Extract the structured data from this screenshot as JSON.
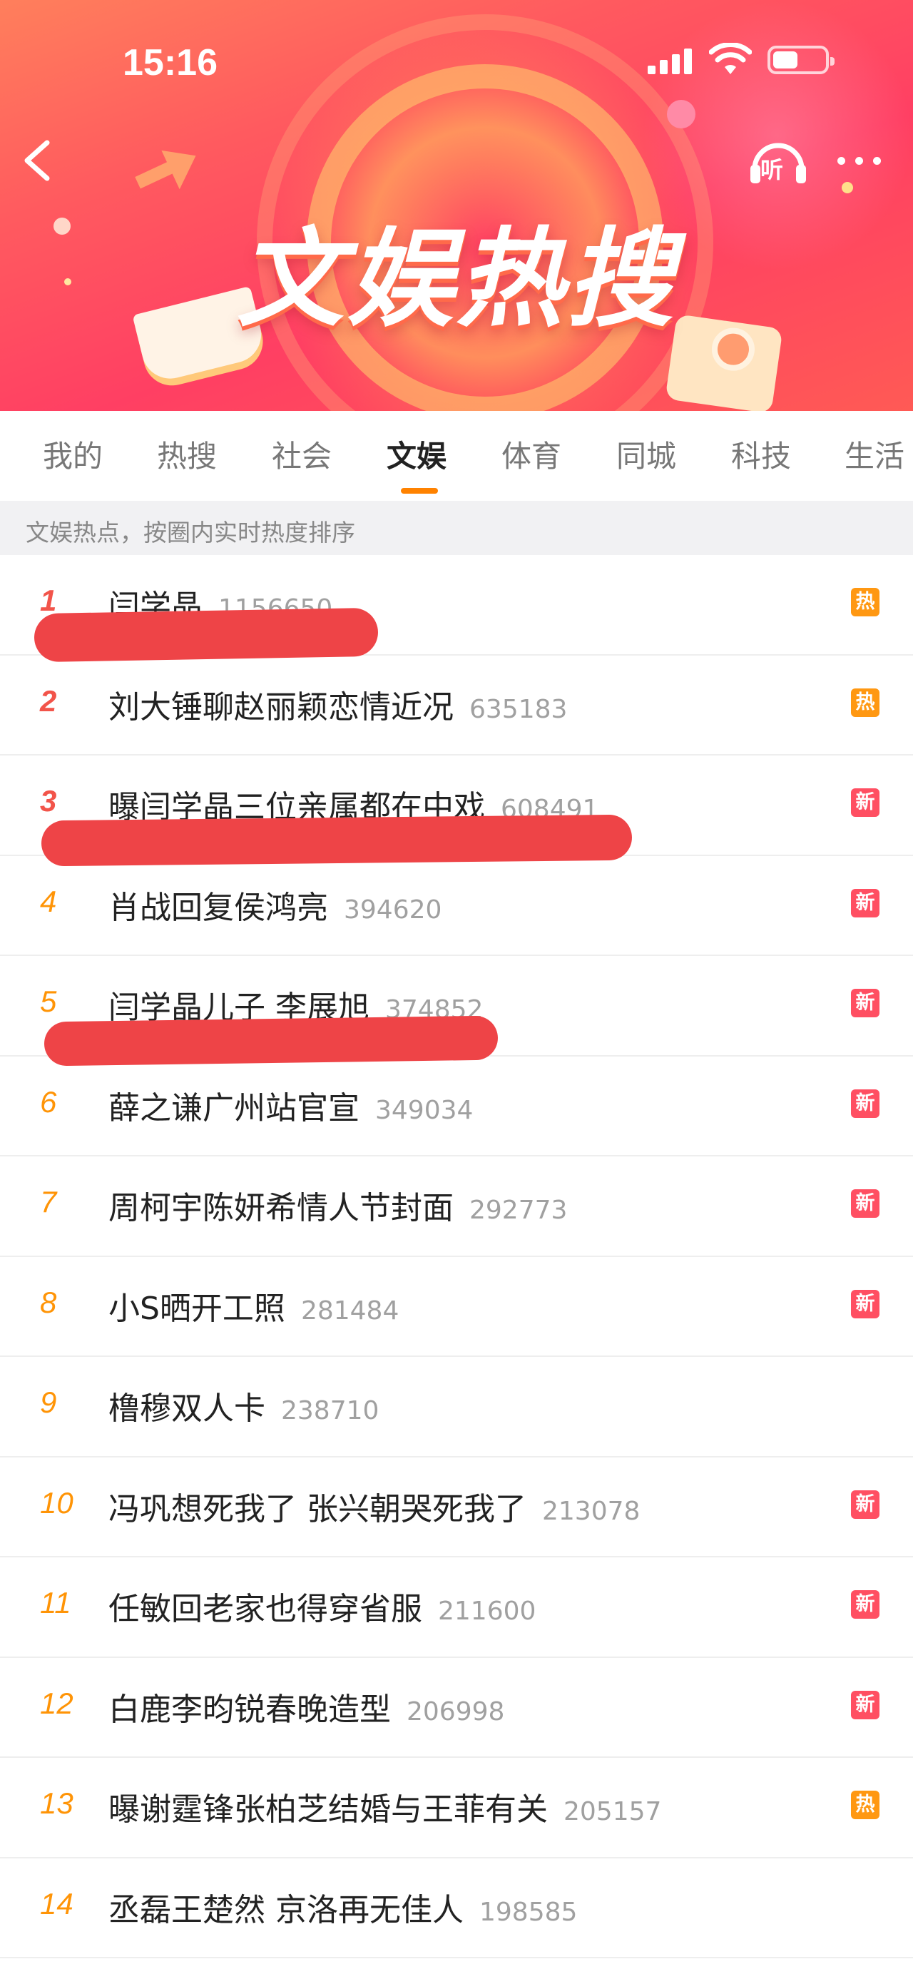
{
  "status_bar": {
    "time": "15:16"
  },
  "banner": {
    "title": "文娱热搜"
  },
  "header": {
    "listen_label": "听"
  },
  "tabs": [
    {
      "label": "我的"
    },
    {
      "label": "热搜"
    },
    {
      "label": "社会"
    },
    {
      "label": "文娱",
      "active": true
    },
    {
      "label": "体育"
    },
    {
      "label": "同城"
    },
    {
      "label": "科技"
    },
    {
      "label": "生活"
    }
  ],
  "subheader": "文娱热点，按圈内实时热度排序",
  "colors": {
    "accent": "#ff8200",
    "hot_badge": "#ff9812",
    "new_badge": "#ff4f62",
    "rank_top": "#f2544a",
    "rank": "#ff9406"
  },
  "list": [
    {
      "rank": "1",
      "topic": "闫学晶",
      "count": "1156650",
      "badge": "热",
      "badge_type": "hot"
    },
    {
      "rank": "2",
      "topic": "刘大锤聊赵丽颖恋情近况",
      "count": "635183",
      "badge": "热",
      "badge_type": "hot"
    },
    {
      "rank": "3",
      "topic": "曝闫学晶三位亲属都在中戏",
      "count": "608491",
      "badge": "新",
      "badge_type": "new"
    },
    {
      "rank": "4",
      "topic": "肖战回复侯鸿亮",
      "count": "394620",
      "badge": "新",
      "badge_type": "new"
    },
    {
      "rank": "5",
      "topic": "闫学晶儿子 李展旭",
      "count": "374852",
      "badge": "新",
      "badge_type": "new"
    },
    {
      "rank": "6",
      "topic": "薛之谦广州站官宣",
      "count": "349034",
      "badge": "新",
      "badge_type": "new"
    },
    {
      "rank": "7",
      "topic": "周柯宇陈妍希情人节封面",
      "count": "292773",
      "badge": "新",
      "badge_type": "new"
    },
    {
      "rank": "8",
      "topic": "小S晒开工照",
      "count": "281484",
      "badge": "新",
      "badge_type": "new"
    },
    {
      "rank": "9",
      "topic": "橹穆双人卡",
      "count": "238710",
      "badge": "",
      "badge_type": "none"
    },
    {
      "rank": "10",
      "topic": "冯巩想死我了 张兴朝哭死我了",
      "count": "213078",
      "badge": "新",
      "badge_type": "new"
    },
    {
      "rank": "11",
      "topic": "任敏回老家也得穿省服",
      "count": "211600",
      "badge": "新",
      "badge_type": "new"
    },
    {
      "rank": "12",
      "topic": "白鹿李昀锐春晚造型",
      "count": "206998",
      "badge": "新",
      "badge_type": "new"
    },
    {
      "rank": "13",
      "topic": "曝谢霆锋张柏芝结婚与王菲有关",
      "count": "205157",
      "badge": "热",
      "badge_type": "hot"
    },
    {
      "rank": "14",
      "topic": "丞磊王楚然 京洛再无佳人",
      "count": "198585",
      "badge": "",
      "badge_type": "none"
    }
  ]
}
